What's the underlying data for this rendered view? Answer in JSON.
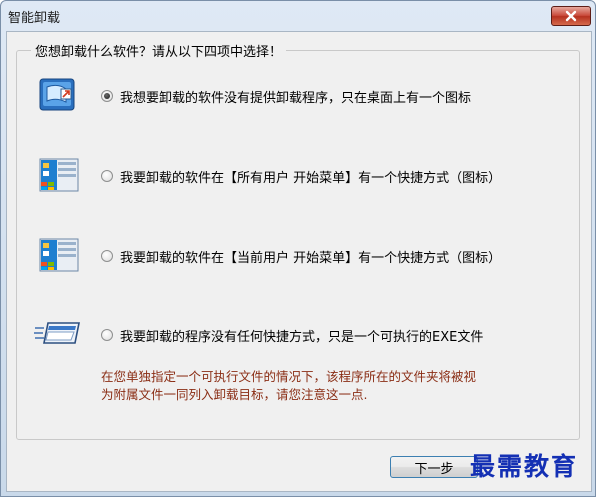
{
  "window": {
    "title": "智能卸载"
  },
  "group": {
    "legend": "您想卸载什么软件？请从以下四项中选择！"
  },
  "options": [
    {
      "icon": "desktop-shortcut-icon",
      "label": "我想要卸载的软件没有提供卸载程序，只在桌面上有一个图标",
      "selected": true
    },
    {
      "icon": "all-users-start-menu-icon",
      "label": "我要卸载的软件在【所有用户  开始菜单】有一个快捷方式（图标）",
      "selected": false
    },
    {
      "icon": "current-user-start-menu-icon",
      "label": "我要卸载的软件在【当前用户  开始菜单】有一个快捷方式（图标）",
      "selected": false
    },
    {
      "icon": "exe-file-icon",
      "label": "我要卸载的程序没有任何快捷方式，只是一个可执行的EXE文件",
      "selected": false
    }
  ],
  "note": {
    "line1": "在您单独指定一个可执行文件的情况下，该程序所在的文件夹将被视",
    "line2": "为附属文件一同列入卸载目标，请您注意这一点."
  },
  "buttons": {
    "next": "下一步"
  },
  "watermark": "最需教育",
  "colors": {
    "note": "#8a2d14",
    "watermark": "#1430b4",
    "close": "#c9493a"
  }
}
